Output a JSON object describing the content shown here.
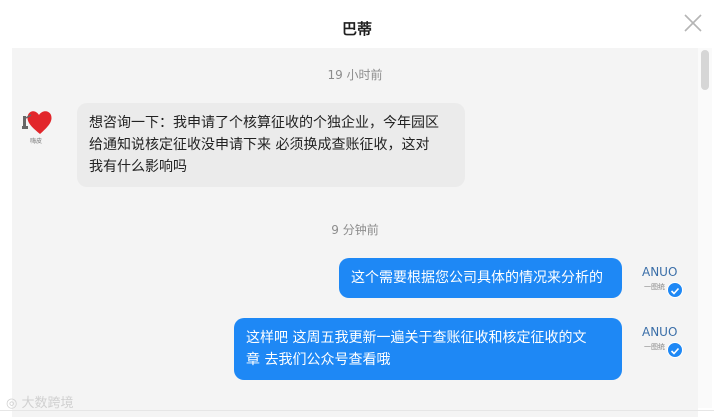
{
  "header": {
    "title": "巴蒂",
    "close_label": "×"
  },
  "timestamps": [
    "19 小时前",
    "9 分钟前"
  ],
  "messages": [
    {
      "from": "user",
      "lines": [
        "想咨询一下：我申请了个核算征收的个独企业，今年园区",
        "给通知说核定征收没申请下来  必须换成查账征收，这对",
        "我有什么影响吗"
      ]
    },
    {
      "from": "agent",
      "lines": [
        "这个需要根据您公司具体的情况来分析的"
      ]
    },
    {
      "from": "agent",
      "lines": [
        "这样吧 这周五我更新一遍关于查账征收和核定征收的文",
        "章 去我们公众号查看哦"
      ]
    }
  ],
  "avatars": {
    "user_caption": "嗨皮",
    "agent_logo_text": "ANUO",
    "agent_sub_text": "一图统"
  },
  "watermark": "大数跨境",
  "colors": {
    "accent": "#1e88f5",
    "incoming_bubble": "#ebebeb",
    "chat_background": "#f4f4f4"
  }
}
